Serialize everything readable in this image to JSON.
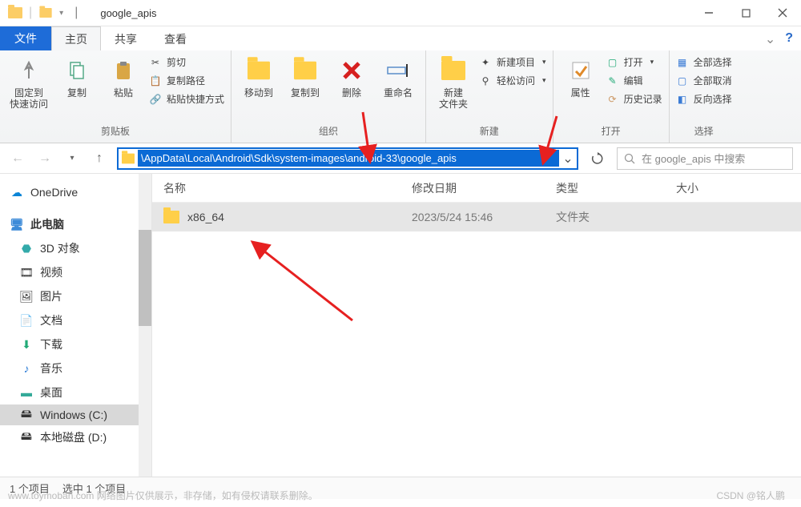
{
  "title": "google_apis",
  "tabs": {
    "file": "文件",
    "home": "主页",
    "share": "共享",
    "view": "查看"
  },
  "ribbon": {
    "clipboard": {
      "label": "剪贴板",
      "pin": "固定到\n快速访问",
      "copy": "复制",
      "paste": "粘贴",
      "cut": "剪切",
      "copypath": "复制路径",
      "pasteshortcut": "粘贴快捷方式"
    },
    "organize": {
      "label": "组织",
      "moveto": "移动到",
      "copyto": "复制到",
      "delete": "删除",
      "rename": "重命名"
    },
    "new": {
      "label": "新建",
      "newfolder": "新建\n文件夹",
      "newitem": "新建项目",
      "easyaccess": "轻松访问"
    },
    "open": {
      "label": "打开",
      "properties": "属性",
      "open": "打开",
      "edit": "编辑",
      "history": "历史记录"
    },
    "select": {
      "label": "选择",
      "selectall": "全部选择",
      "selectnone": "全部取消",
      "invert": "反向选择"
    }
  },
  "address": "\\AppData\\Local\\Android\\Sdk\\system-images\\android-33\\google_apis",
  "search_placeholder": "在 google_apis 中搜索",
  "columns": {
    "name": "名称",
    "date": "修改日期",
    "type": "类型",
    "size": "大小"
  },
  "rows": [
    {
      "name": "x86_64",
      "date": "2023/5/24 15:46",
      "type": "文件夹"
    }
  ],
  "sidebar": {
    "onedrive": "OneDrive",
    "thispc": "此电脑",
    "items": [
      {
        "label": "3D 对象"
      },
      {
        "label": "视频"
      },
      {
        "label": "图片"
      },
      {
        "label": "文档"
      },
      {
        "label": "下载"
      },
      {
        "label": "音乐"
      },
      {
        "label": "桌面"
      },
      {
        "label": "Windows (C:)"
      },
      {
        "label": "本地磁盘 (D:)"
      }
    ]
  },
  "status": {
    "count": "1 个项目",
    "selected": "选中 1 个项目"
  },
  "watermark_left": "www.toymoban.com  网络图片仅供展示，非存储，如有侵权请联系删除。",
  "watermark_right": "CSDN @铭人鹏"
}
